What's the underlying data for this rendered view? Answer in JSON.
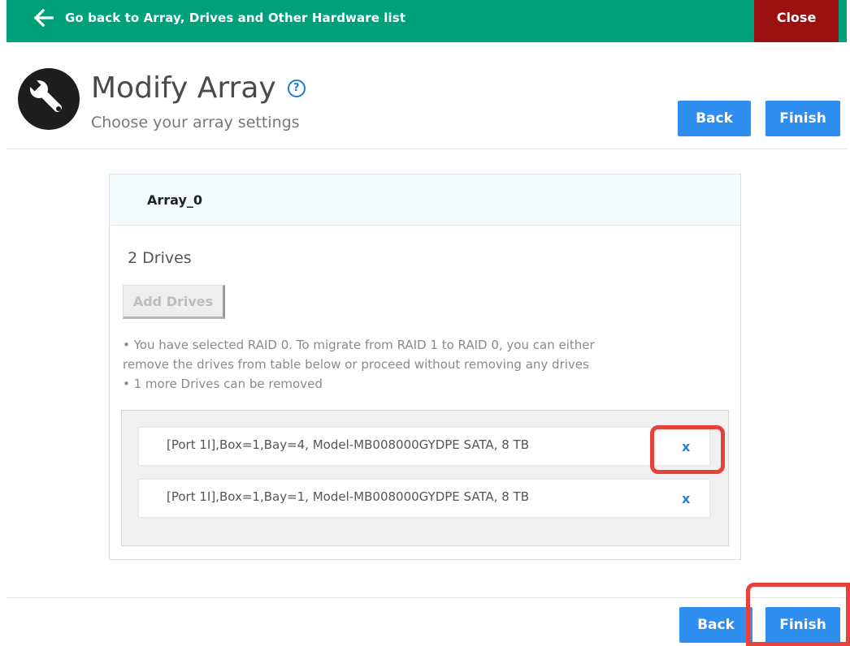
{
  "topbar": {
    "back_label": "Go back to Array, Drives and Other Hardware list",
    "close_label": "Close"
  },
  "header": {
    "title": "Modify Array",
    "help_symbol": "?",
    "subtitle": "Choose your array settings",
    "back_label": "Back",
    "finish_label": "Finish"
  },
  "array": {
    "name": "Array_0",
    "drive_count": "2  Drives",
    "add_drives_label": "Add Drives",
    "info_line_1": "• You have selected RAID 0. To migrate from RAID 1 to RAID 0, you can either",
    "info_line_2": "remove the drives from table below or proceed without removing any drives",
    "info_line_3": "• 1 more Drives can be removed",
    "drives": [
      {
        "description": "[Port 1I],Box=1,Bay=4, Model-MB008000GYDPE SATA, 8 TB",
        "remove_label": "x"
      },
      {
        "description": "[Port 1I],Box=1,Bay=1, Model-MB008000GYDPE SATA, 8 TB",
        "remove_label": "x"
      }
    ]
  },
  "footer": {
    "back_label": "Back",
    "finish_label": "Finish"
  },
  "icons": {
    "back_arrow": "arrow-left-icon",
    "wrench": "wrench-icon",
    "help": "help-icon"
  },
  "colors": {
    "topbar": "#00a07a",
    "close": "#9b1111",
    "primary_button": "#2f8ff0",
    "highlight": "#e6413b"
  }
}
